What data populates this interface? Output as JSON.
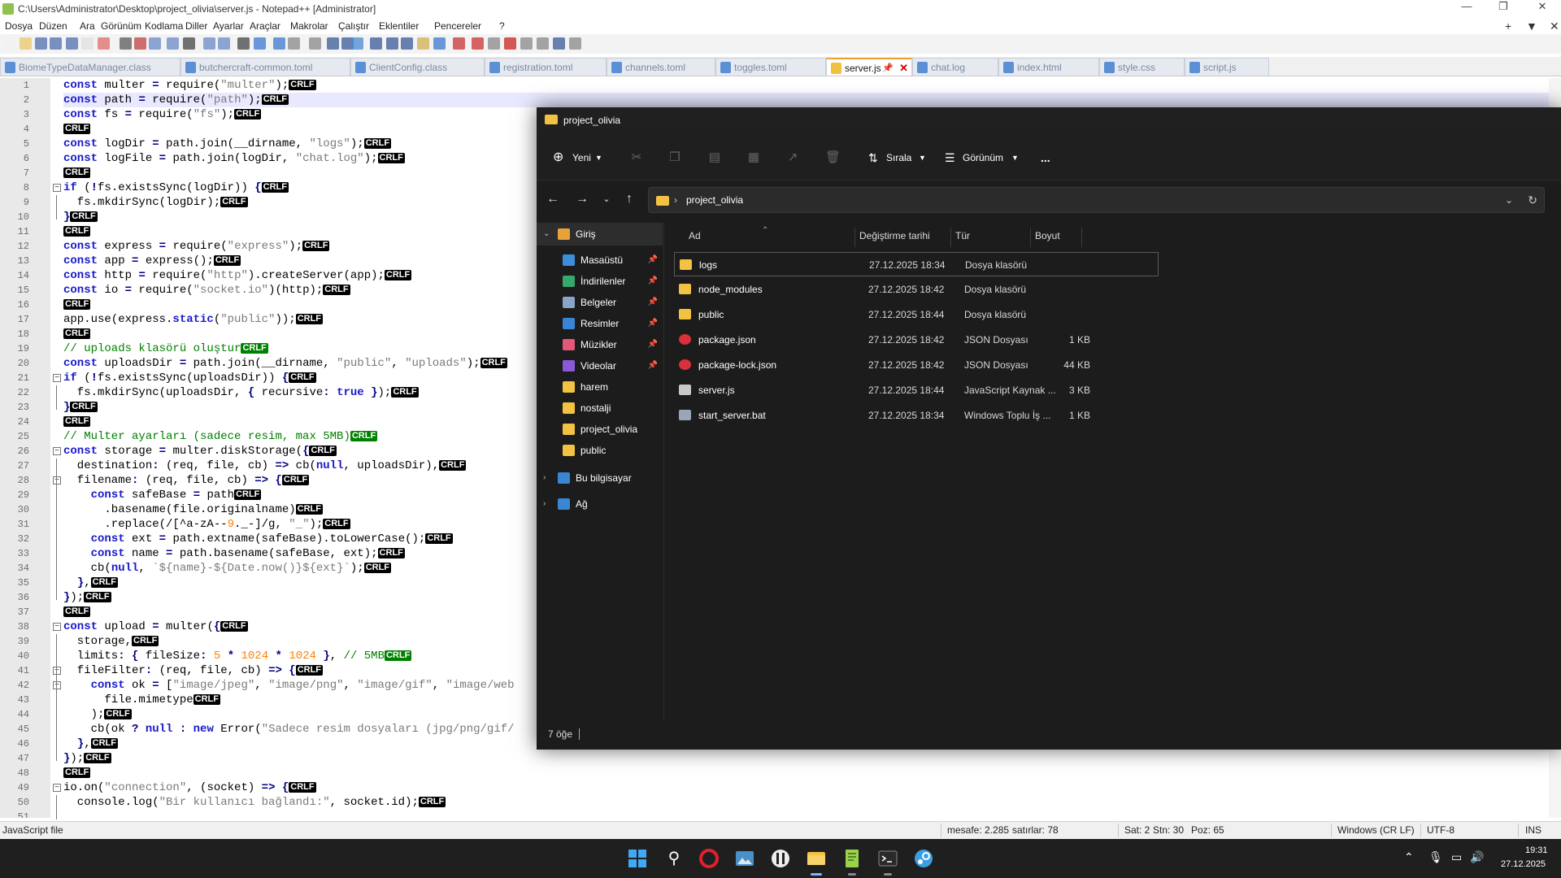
{
  "npp": {
    "title": "C:\\Users\\Administrator\\Desktop\\project_olivia\\server.js - Notepad++ [Administrator]",
    "menu": [
      "Dosya",
      "Düzen",
      "Ara",
      "Görünüm",
      "Kodlama",
      "Diller",
      "Ayarlar",
      "Araçlar",
      "Makrolar",
      "Çalıştır",
      "Eklentiler",
      "Pencereler",
      "?"
    ],
    "menu_right": [
      "+",
      "▼",
      "✕"
    ],
    "tabs": [
      "BiomeTypeDataManager.class",
      "butchercraft-common.toml",
      "ClientConfig.class",
      "registration.toml",
      "channels.toml",
      "toggles.toml",
      "server.js",
      "chat.log",
      "index.html",
      "style.css",
      "script.js"
    ],
    "active_tab": "server.js",
    "status": {
      "filetype": "JavaScript file",
      "length": "mesafe: 2.285",
      "lines": "satırlar: 78",
      "ln": "Sat: 2",
      "col": "Stn: 30",
      "pos": "Poz: 65",
      "eol": "Windows (CR LF)",
      "encoding": "UTF-8",
      "mode": "INS"
    },
    "line_numbers": [
      "1",
      "2",
      "3",
      "4",
      "5",
      "6",
      "7",
      "8",
      "9",
      "10",
      "11",
      "12",
      "13",
      "14",
      "15",
      "16",
      "17",
      "18",
      "19",
      "20",
      "21",
      "22",
      "23",
      "24",
      "25",
      "26",
      "27",
      "28",
      "29",
      "30",
      "31",
      "32",
      "33",
      "34",
      "35",
      "36",
      "37",
      "38",
      "39",
      "40",
      "41",
      "42",
      "43",
      "44",
      "45",
      "46",
      "47",
      "48",
      "49",
      "50",
      "51"
    ],
    "code_lines": [
      "const multer = require(\"multer\");",
      "const path = require(\"path\");",
      "const fs = require(\"fs\");",
      "",
      "const logDir = path.join(__dirname, \"logs\");",
      "const logFile = path.join(logDir, \"chat.log\");",
      "",
      "if (!fs.existsSync(logDir)) {",
      "  fs.mkdirSync(logDir);",
      "}",
      "",
      "const express = require(\"express\");",
      "const app = express();",
      "const http = require(\"http\").createServer(app);",
      "const io = require(\"socket.io\")(http);",
      "",
      "app.use(express.static(\"public\"));",
      "",
      "// uploads klasörü oluştur",
      "const uploadsDir = path.join(__dirname, \"public\", \"uploads\");",
      "if (!fs.existsSync(uploadsDir)) {",
      "  fs.mkdirSync(uploadsDir, { recursive: true });",
      "}",
      "",
      "// Multer ayarları (sadece resim, max 5MB)",
      "const storage = multer.diskStorage({",
      "  destination: (req, file, cb) => cb(null, uploadsDir),",
      "  filename: (req, file, cb) => {",
      "    const safeBase = path",
      "      .basename(file.originalname)",
      "      .replace(/[^a-zA-Z0-9._-]/g, \"_\");",
      "    const ext = path.extname(safeBase).toLowerCase();",
      "    const name = path.basename(safeBase, ext);",
      "    cb(null, `${name}-${Date.now()}${ext}`);",
      "  },",
      "});",
      "",
      "const upload = multer({",
      "  storage,",
      "  limits: { fileSize: 5 * 1024 * 1024 }, // 5MB",
      "  fileFilter: (req, file, cb) => {",
      "    const ok = [\"image/jpeg\", \"image/png\", \"image/gif\", \"image/web",
      "      file.mimetype",
      "    );",
      "    cb(ok ? null : new Error(\"Sadece resim dosyaları (jpg/png/gif/",
      "  },",
      "});",
      "",
      "io.on(\"connection\", (socket) => {",
      "  console.log(\"Bir kullanıcı bağlandı:\", socket.id);",
      ""
    ],
    "crlf_label": "CRLF"
  },
  "explorer": {
    "title": "project_olivia",
    "cmd": {
      "new": "Yeni",
      "sort": "Sırala",
      "view": "Görünüm",
      "more": "..."
    },
    "address": "project_olivia",
    "nav": [
      {
        "label": "Giriş",
        "color": "#e8a23c"
      },
      {
        "label": "Masaüstü",
        "color": "#3b8fd9",
        "pin": true
      },
      {
        "label": "İndirilenler",
        "color": "#37a86b",
        "pin": true
      },
      {
        "label": "Belgeler",
        "color": "#8aa4c8",
        "pin": true
      },
      {
        "label": "Resimler",
        "color": "#3a86d4",
        "pin": true
      },
      {
        "label": "Müzikler",
        "color": "#e4567a",
        "pin": true
      },
      {
        "label": "Videolar",
        "color": "#8a5ad6",
        "pin": true
      },
      {
        "label": "harem",
        "color": "#f4c242"
      },
      {
        "label": "nostalji",
        "color": "#f4c242"
      },
      {
        "label": "project_olivia",
        "color": "#f4c242"
      },
      {
        "label": "public",
        "color": "#f4c242"
      },
      {
        "label": "Bu bilgisayar",
        "color": "#3a86d4"
      },
      {
        "label": "Ağ",
        "color": "#3a86d4"
      }
    ],
    "columns": {
      "name": "Ad",
      "date": "Değiştirme tarihi",
      "type": "Tür",
      "size": "Boyut"
    },
    "files": [
      {
        "name": "logs",
        "date": "27.12.2025 18:34",
        "type": "Dosya klasörü",
        "size": "",
        "color": "#f4c242"
      },
      {
        "name": "node_modules",
        "date": "27.12.2025 18:42",
        "type": "Dosya klasörü",
        "size": "",
        "color": "#f4c242"
      },
      {
        "name": "public",
        "date": "27.12.2025 18:44",
        "type": "Dosya klasörü",
        "size": "",
        "color": "#f4c242"
      },
      {
        "name": "package.json",
        "date": "27.12.2025 18:42",
        "type": "JSON Dosyası",
        "size": "1 KB",
        "color": "#d9303a"
      },
      {
        "name": "package-lock.json",
        "date": "27.12.2025 18:42",
        "type": "JSON Dosyası",
        "size": "44 KB",
        "color": "#d9303a"
      },
      {
        "name": "server.js",
        "date": "27.12.2025 18:44",
        "type": "JavaScript Kaynak ...",
        "size": "3 KB",
        "color": "#c8c8c8"
      },
      {
        "name": "start_server.bat",
        "date": "27.12.2025 18:34",
        "type": "Windows Toplu İş ...",
        "size": "1 KB",
        "color": "#9aa6b8"
      }
    ],
    "status": "7 öğe"
  },
  "taskbar": {
    "time": "19:31",
    "date": "27.12.2025"
  }
}
